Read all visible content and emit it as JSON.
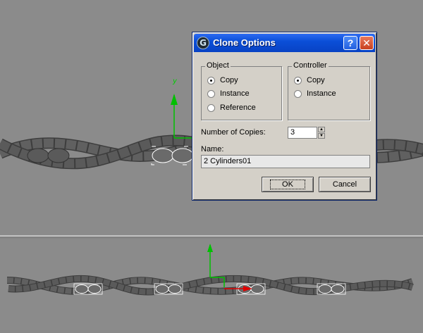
{
  "dialog": {
    "title": "Clone Options",
    "help_label": "?",
    "close_label": "✕",
    "object_group": {
      "label": "Object",
      "options": [
        "Copy",
        "Instance",
        "Reference"
      ],
      "selected": "Copy"
    },
    "controller_group": {
      "label": "Controller",
      "options": [
        "Copy",
        "Instance"
      ],
      "selected": "Copy"
    },
    "copies_label": "Number of Copies:",
    "copies_value": "3",
    "name_label": "Name:",
    "name_value": "2 Cylinders01",
    "ok_label": "OK",
    "cancel_label": "Cancel"
  },
  "viewport": {
    "axis_y_label": "y",
    "gizmo_colors": {
      "y": "#00c000",
      "x": "#e00000"
    }
  }
}
